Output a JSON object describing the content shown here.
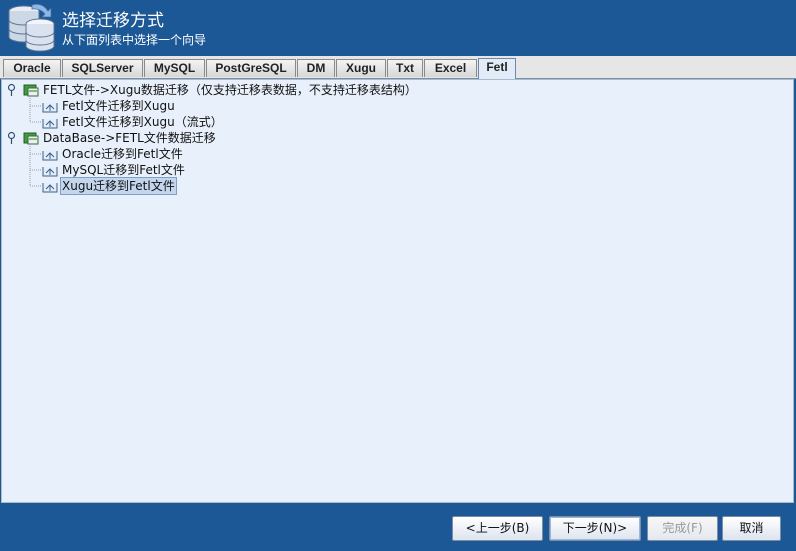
{
  "header": {
    "title": "选择迁移方式",
    "subtitle": "从下面列表中选择一个向导"
  },
  "tabs": [
    {
      "label": "Oracle"
    },
    {
      "label": "SQLServer"
    },
    {
      "label": "MySQL"
    },
    {
      "label": "PostGreSQL"
    },
    {
      "label": "DM"
    },
    {
      "label": "Xugu"
    },
    {
      "label": "Txt"
    },
    {
      "label": "Excel"
    },
    {
      "label": "Fetl",
      "active": true
    }
  ],
  "tree": {
    "groups": [
      {
        "label": "FETL文件->Xugu数据迁移（仅支持迁移表数据，不支持迁移表结构）",
        "items": [
          {
            "label": "Fetl文件迁移到Xugu"
          },
          {
            "label": "Fetl文件迁移到Xugu（流式）"
          }
        ]
      },
      {
        "label": "DataBase->FETL文件数据迁移",
        "items": [
          {
            "label": "Oracle迁移到Fetl文件"
          },
          {
            "label": "MySQL迁移到Fetl文件"
          },
          {
            "label": "Xugu迁移到Fetl文件",
            "selected": true
          }
        ]
      }
    ]
  },
  "buttons": {
    "prev": "<上一步(B)",
    "next": "下一步(N)>",
    "finish": "完成(F)",
    "cancel": "取消"
  }
}
